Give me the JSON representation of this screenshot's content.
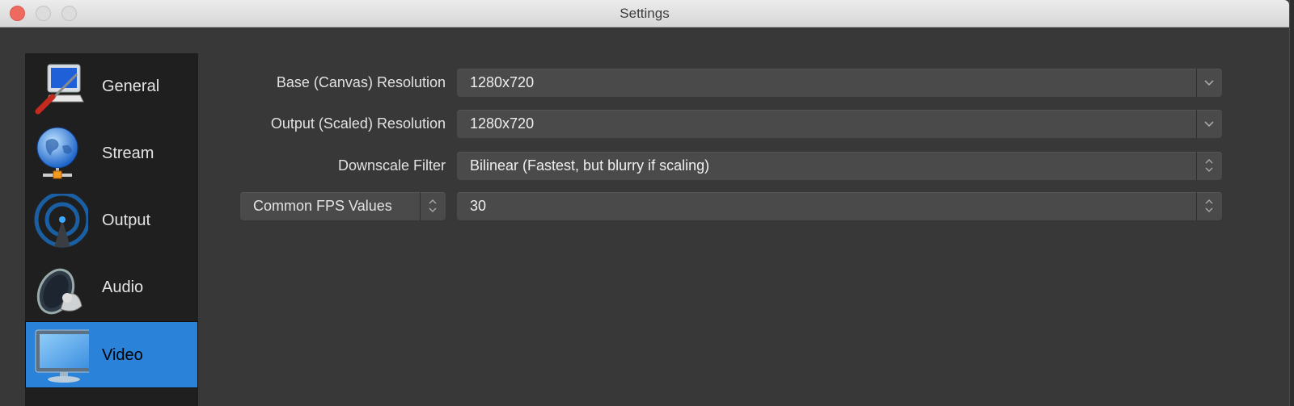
{
  "window": {
    "title": "Settings",
    "traffic_lights": [
      "close",
      "minimize",
      "zoom"
    ]
  },
  "sidebar": {
    "items": [
      {
        "label": "General",
        "icon": "monitor-screwdriver-icon",
        "selected": false
      },
      {
        "label": "Stream",
        "icon": "globe-network-icon",
        "selected": false
      },
      {
        "label": "Output",
        "icon": "broadcast-antenna-icon",
        "selected": false
      },
      {
        "label": "Audio",
        "icon": "speaker-icon",
        "selected": false
      },
      {
        "label": "Video",
        "icon": "monitor-icon",
        "selected": true
      }
    ],
    "selected_color": "#2b82d9"
  },
  "video": {
    "base_resolution": {
      "label": "Base (Canvas) Resolution",
      "value": "1280x720",
      "control": "editable-combo",
      "button_icon": "chevron-down-icon"
    },
    "output_resolution": {
      "label": "Output (Scaled) Resolution",
      "value": "1280x720",
      "control": "editable-combo",
      "button_icon": "chevron-down-icon"
    },
    "downscale_filter": {
      "label": "Downscale Filter",
      "value": "Bilinear (Fastest, but blurry if scaling)",
      "control": "select",
      "button_icon": "up-down-chevron-icon"
    },
    "fps": {
      "type_value": "Common FPS Values",
      "value": "30",
      "control": "select",
      "button_icon": "up-down-chevron-icon"
    }
  }
}
